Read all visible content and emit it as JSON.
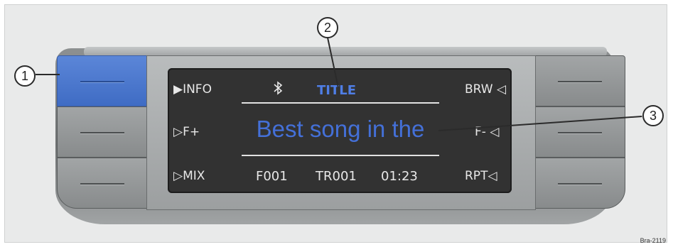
{
  "left_labels": [
    "▶INFO",
    "▷F+",
    "▷MIX"
  ],
  "right_labels": [
    "BRW ◁",
    "F- ◁",
    "RPT◁"
  ],
  "screen": {
    "bluetooth_icon": "bluetooth-icon",
    "title": "TITLE",
    "song": "Best song in the",
    "folder": "F001",
    "track": "TR001",
    "time": "01:23"
  },
  "callouts": [
    "1",
    "2",
    "3"
  ],
  "image_code": "Bra-2119",
  "colors": {
    "highlight": "#4470d8",
    "screen": "#323232",
    "highlight_button": "#4a78d0"
  }
}
